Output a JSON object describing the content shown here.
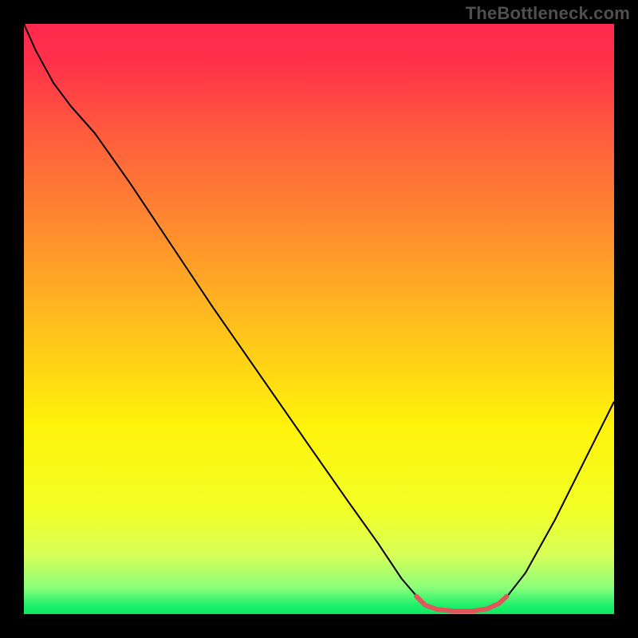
{
  "watermark": "TheBottleneck.com",
  "chart_data": {
    "type": "line",
    "title": "",
    "xlabel": "",
    "ylabel": "",
    "xlim": [
      0,
      100
    ],
    "ylim": [
      0,
      100
    ],
    "background_gradient": {
      "stops": [
        {
          "offset": 0.0,
          "color": "#ff2a4d"
        },
        {
          "offset": 0.06,
          "color": "#ff2f4a"
        },
        {
          "offset": 0.18,
          "color": "#ff5a3e"
        },
        {
          "offset": 0.34,
          "color": "#ff8a2f"
        },
        {
          "offset": 0.52,
          "color": "#ffc21c"
        },
        {
          "offset": 0.68,
          "color": "#fff30a"
        },
        {
          "offset": 0.82,
          "color": "#f3ff25"
        },
        {
          "offset": 0.9,
          "color": "#d7ff58"
        },
        {
          "offset": 0.955,
          "color": "#8cff7a"
        },
        {
          "offset": 0.985,
          "color": "#1ef06a"
        },
        {
          "offset": 1.0,
          "color": "#0ee860"
        }
      ]
    },
    "series": [
      {
        "name": "bottleneck-curve",
        "color": "#000000",
        "width": 2.0,
        "points": [
          {
            "x": 0.0,
            "y": 100.0
          },
          {
            "x": 2.0,
            "y": 95.5
          },
          {
            "x": 5.0,
            "y": 90.0
          },
          {
            "x": 8.0,
            "y": 86.0
          },
          {
            "x": 12.0,
            "y": 81.5
          },
          {
            "x": 18.0,
            "y": 73.0
          },
          {
            "x": 25.0,
            "y": 62.5
          },
          {
            "x": 32.0,
            "y": 52.0
          },
          {
            "x": 40.0,
            "y": 40.5
          },
          {
            "x": 48.0,
            "y": 29.0
          },
          {
            "x": 55.0,
            "y": 19.0
          },
          {
            "x": 60.0,
            "y": 12.0
          },
          {
            "x": 64.0,
            "y": 6.0
          },
          {
            "x": 67.0,
            "y": 2.5
          },
          {
            "x": 69.0,
            "y": 1.0
          },
          {
            "x": 72.0,
            "y": 0.4
          },
          {
            "x": 76.0,
            "y": 0.4
          },
          {
            "x": 79.0,
            "y": 1.0
          },
          {
            "x": 81.5,
            "y": 2.5
          },
          {
            "x": 85.0,
            "y": 7.0
          },
          {
            "x": 90.0,
            "y": 16.0
          },
          {
            "x": 95.0,
            "y": 26.0
          },
          {
            "x": 100.0,
            "y": 36.0
          }
        ]
      },
      {
        "name": "optimal-range-marker",
        "color": "#e0575b",
        "width": 6.0,
        "points": [
          {
            "x": 66.5,
            "y": 3.0
          },
          {
            "x": 68.0,
            "y": 1.5
          },
          {
            "x": 70.0,
            "y": 0.8
          },
          {
            "x": 73.0,
            "y": 0.5
          },
          {
            "x": 76.0,
            "y": 0.5
          },
          {
            "x": 78.5,
            "y": 0.9
          },
          {
            "x": 80.5,
            "y": 1.8
          },
          {
            "x": 81.8,
            "y": 3.0
          }
        ]
      }
    ]
  }
}
